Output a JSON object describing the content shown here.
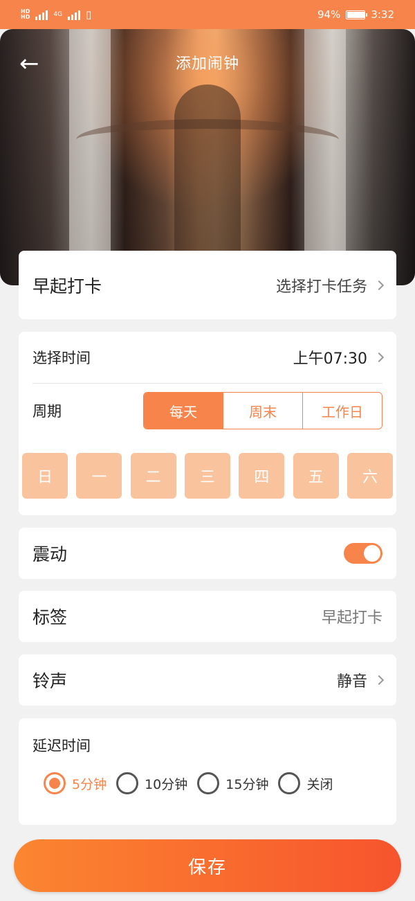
{
  "status_bar": {
    "hd_top": "HD",
    "hd_bottom": "HD",
    "network": "4G",
    "battery_percent_text": "94%",
    "battery_level": 0.94,
    "time": "3:32"
  },
  "header": {
    "title": "添加闹钟",
    "back_icon": "arrow-left-icon"
  },
  "checkin": {
    "label": "早起打卡",
    "value": "选择打卡任务"
  },
  "time_card": {
    "time_label": "选择时间",
    "time_value": "上午07:30",
    "period_label": "周期",
    "period_options": [
      "每天",
      "周末",
      "工作日"
    ],
    "period_selected": "每天",
    "days": [
      "日",
      "一",
      "二",
      "三",
      "四",
      "五",
      "六"
    ]
  },
  "vibrate": {
    "label": "震动",
    "enabled": true
  },
  "tag": {
    "label": "标签",
    "value": "早起打卡"
  },
  "ringtone": {
    "label": "铃声",
    "value": "静音"
  },
  "delay": {
    "label": "延迟时间",
    "options": [
      "5分钟",
      "10分钟",
      "15分钟",
      "关闭"
    ],
    "selected": "5分钟"
  },
  "save_label": "保存",
  "colors": {
    "accent": "#f7844a",
    "day_chip": "#f9c39d",
    "save_gradient_start": "#fb8630",
    "save_gradient_end": "#f7542d"
  }
}
